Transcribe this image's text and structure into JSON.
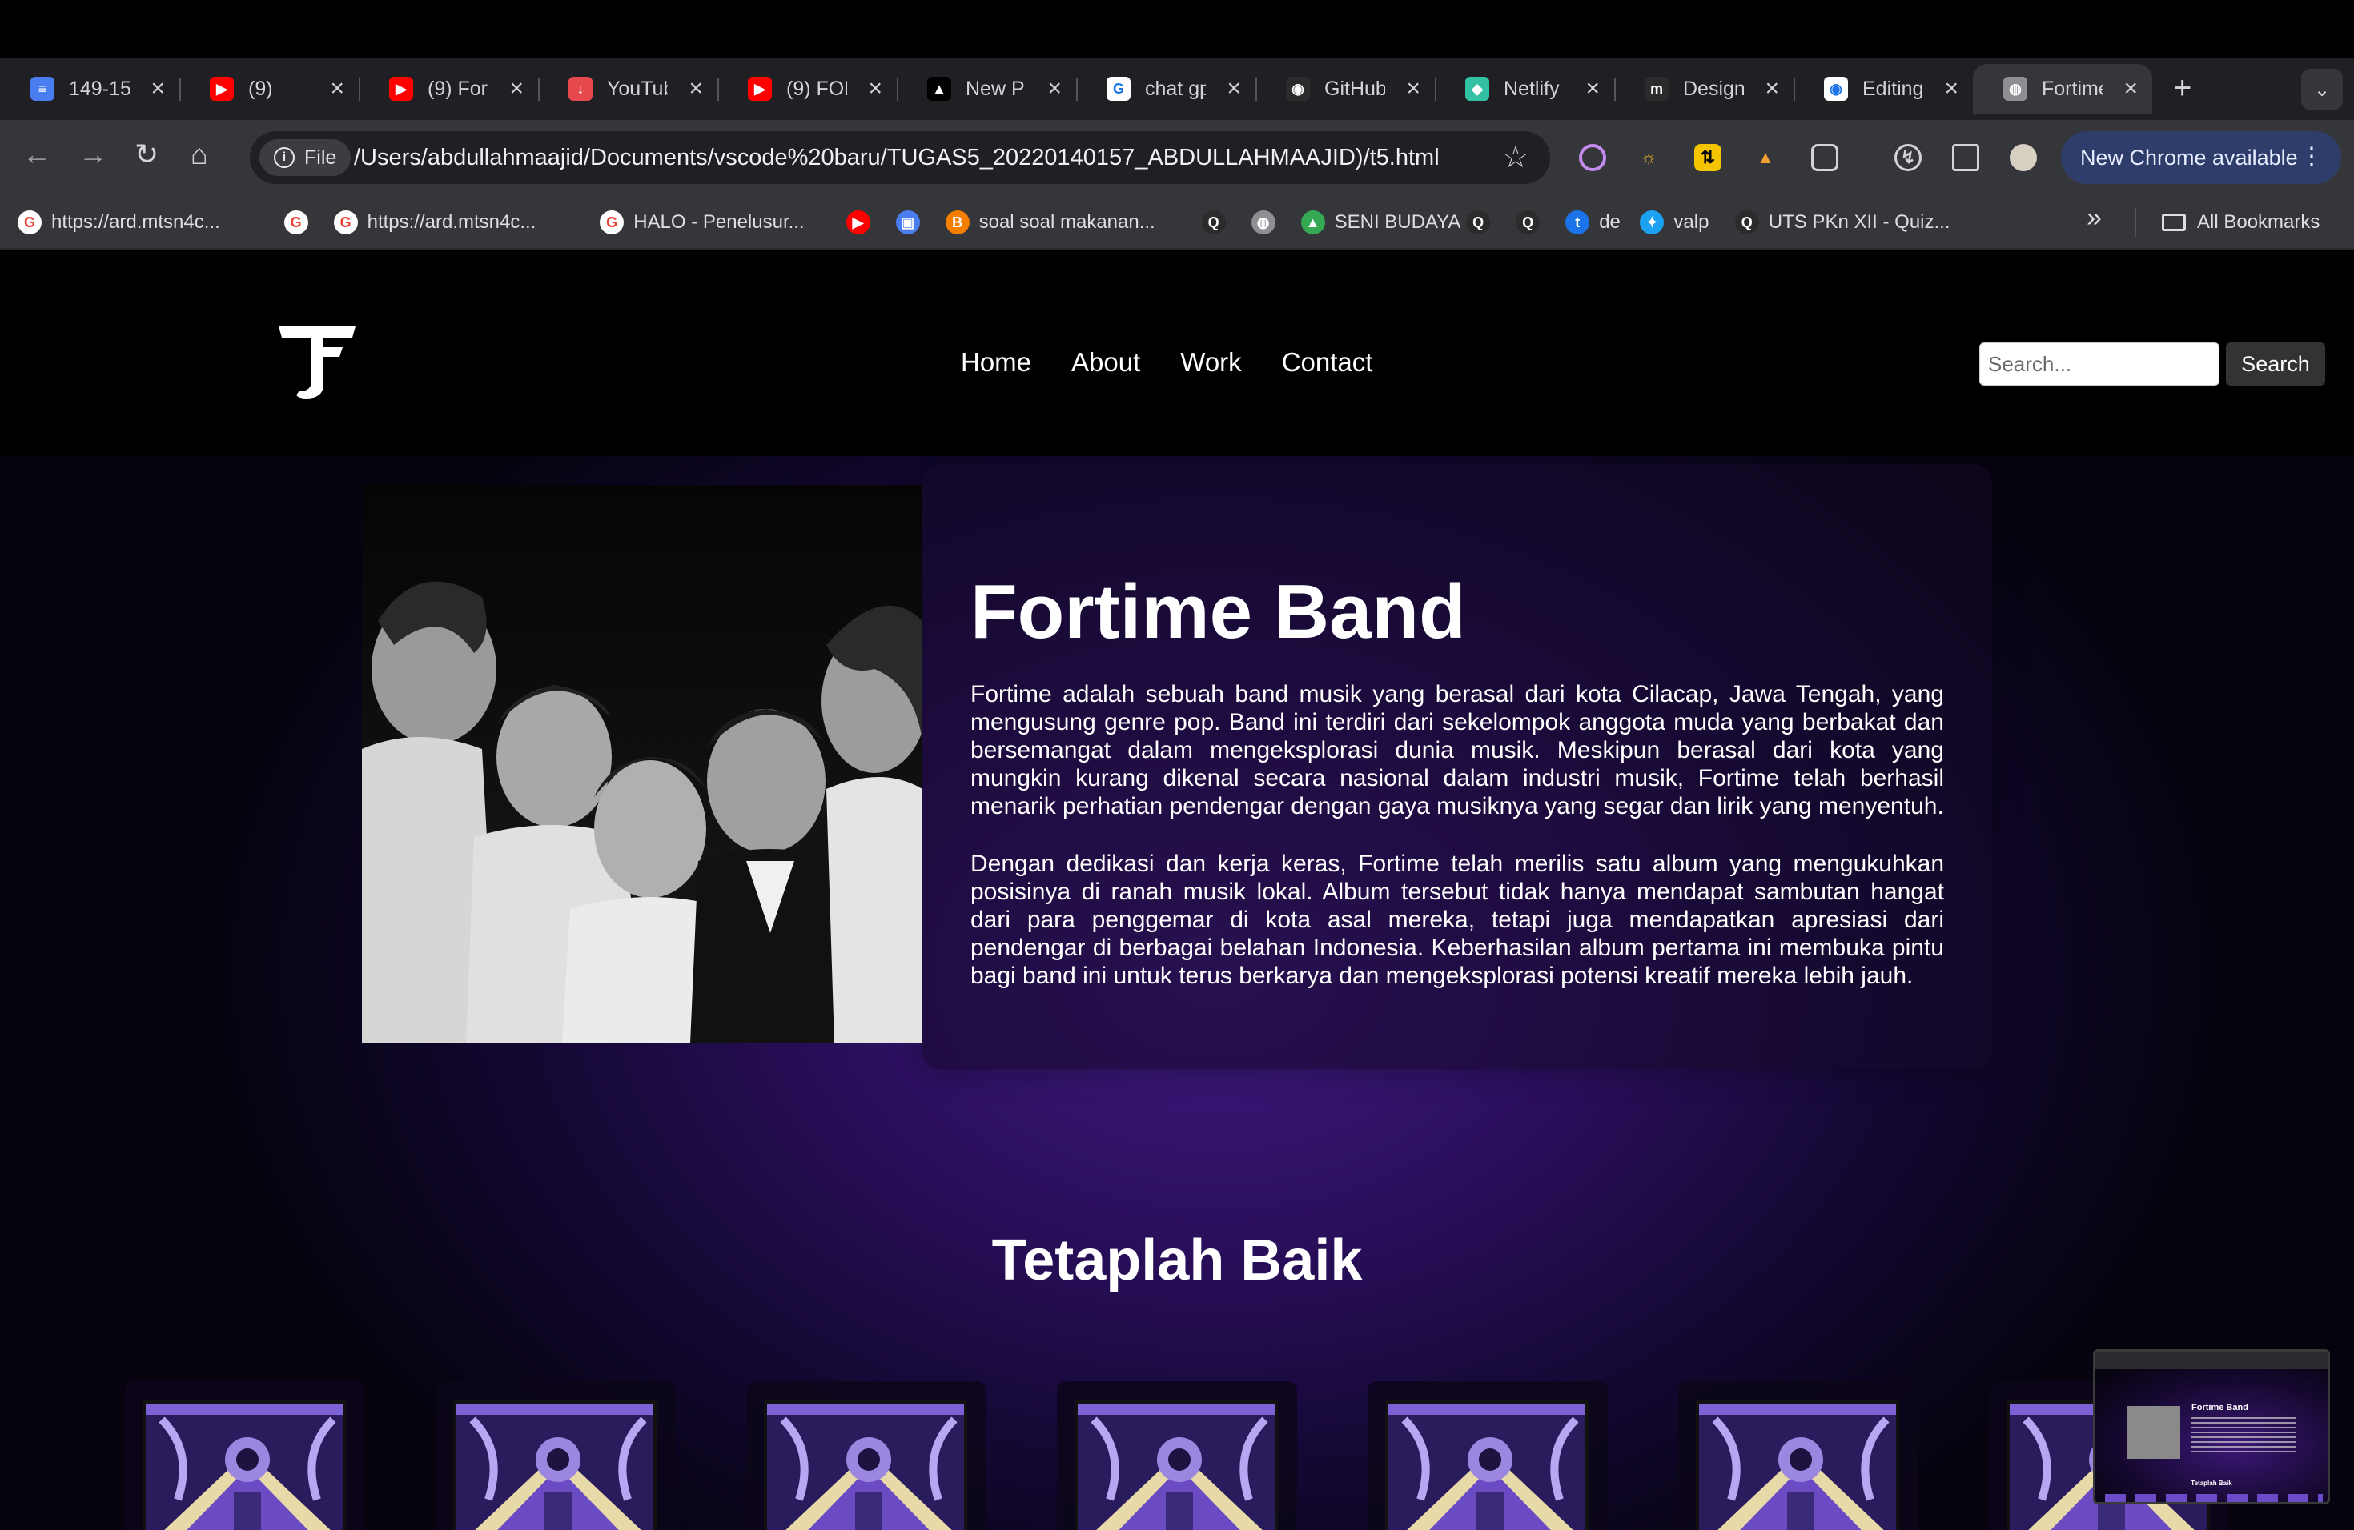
{
  "browser": {
    "tabs": [
      {
        "title": "149-15",
        "favicon": "docs-icon",
        "color": "#4a7ef0"
      },
      {
        "title": "(9)",
        "favicon": "youtube-icon",
        "color": "#ff0000"
      },
      {
        "title": "(9) For",
        "favicon": "youtube-icon",
        "color": "#ff0000"
      },
      {
        "title": "YouTub",
        "favicon": "download-icon",
        "color": "#e5484d"
      },
      {
        "title": "(9) FOF",
        "favicon": "youtube-icon",
        "color": "#ff0000"
      },
      {
        "title": "New Pr",
        "favicon": "vercel-icon",
        "color": "#000000"
      },
      {
        "title": "chat gp",
        "favicon": "google-icon",
        "color": "#ffffff"
      },
      {
        "title": "GitHub",
        "favicon": "github-icon",
        "color": "#2b2b2b"
      },
      {
        "title": "Netlify",
        "favicon": "netlify-icon",
        "color": "#32c2a3"
      },
      {
        "title": "Design",
        "favicon": "design-icon",
        "color": "#2b2b2b"
      },
      {
        "title": "Editing",
        "favicon": "github-icon",
        "color": "#ffffff"
      },
      {
        "title": "Fortime",
        "favicon": "globe-icon",
        "color": "#8e8e93"
      }
    ],
    "new_tab": "+",
    "chip_label": "File",
    "url": "/Users/abdullahmaajid/Documents/vscode%20baru/TUGAS5_20220140157_ABDULLAHMAAJID)/t5.html",
    "update_label": "New Chrome available",
    "bookmarks": [
      {
        "label": "https://ard.mtsn4c...",
        "icon": "google-icon"
      },
      {
        "label": "",
        "icon": "google-icon"
      },
      {
        "label": "https://ard.mtsn4c...",
        "icon": "google-icon"
      },
      {
        "label": "HALO - Penelusur...",
        "icon": "google-icon"
      },
      {
        "label": "",
        "icon": "youtube-icon"
      },
      {
        "label": "",
        "icon": "tv-icon"
      },
      {
        "label": "soal soal makanan...",
        "icon": "blogger-icon"
      },
      {
        "label": "",
        "icon": "quizizz-icon"
      },
      {
        "label": "",
        "icon": "globe-icon"
      },
      {
        "label": "SENI BUDAYA",
        "icon": "drive-icon"
      },
      {
        "label": "",
        "icon": "quizizz-icon"
      },
      {
        "label": "",
        "icon": "quizizz-icon"
      },
      {
        "label": "de",
        "icon": "translate-icon"
      },
      {
        "label": "valp",
        "icon": "twitter-icon"
      },
      {
        "label": "UTS PKn XII - Quiz...",
        "icon": "quizizz-icon"
      }
    ],
    "bookmarks_overflow": "»",
    "all_bookmarks": "All Bookmarks"
  },
  "site": {
    "logo": "F",
    "nav": [
      "Home",
      "About",
      "Work",
      "Contact"
    ],
    "search_placeholder": "Search...",
    "search_button": "Search",
    "hero": {
      "title": "Fortime Band",
      "paragraphs": [
        "Fortime adalah sebuah band musik yang berasal dari kota Cilacap, Jawa Tengah, yang mengusung genre pop. Band ini terdiri dari sekelompok anggota muda yang berbakat dan bersemangat dalam mengeksplorasi dunia musik. Meskipun berasal dari kota yang mungkin kurang dikenal secara nasional dalam industri musik, Fortime telah berhasil menarik perhatian pendengar dengan gaya musiknya yang segar dan lirik yang menyentuh.",
        "Dengan dedikasi dan kerja keras, Fortime telah merilis satu album yang mengukuhkan posisinya di ranah musik lokal. Album tersebut tidak hanya mendapat sambutan hangat dari para penggemar di kota asal mereka, tetapi juga mendapatkan apresiasi dari pendengar di berbagai belahan Indonesia. Keberhasilan album pertama ini membuka pintu bagi band ini untuk terus berkarya dan mengeksplorasi potensi kreatif mereka lebih jauh."
      ]
    },
    "section_title": "Tetaplah Baik",
    "album_count": 7,
    "colors": {
      "accent_purple": "#3e1a80",
      "card": "#140a28"
    }
  },
  "pip": {
    "title": "Fortime Band",
    "section": "Tetaplah Baik"
  }
}
